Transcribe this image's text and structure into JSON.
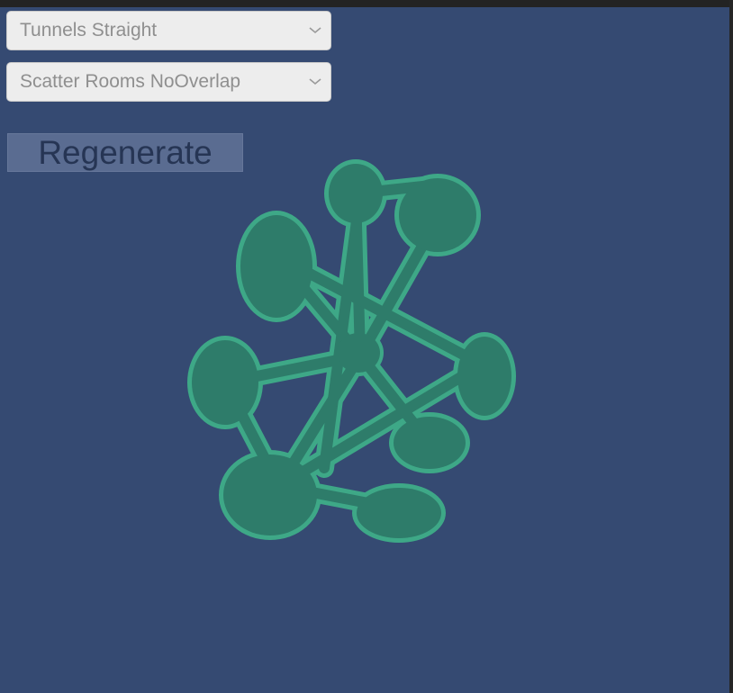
{
  "controls": {
    "tunnel_dropdown": {
      "selected": "Tunnels Straight"
    },
    "rooms_dropdown": {
      "selected": "Scatter Rooms NoOverlap"
    },
    "regenerate_label": "Regenerate"
  },
  "icons": {
    "dropdown_arrow": "chevron-down-icon"
  },
  "colors": {
    "background": "#354a72",
    "room_fill": "#2e7c6a",
    "room_outline": "#3ea887",
    "dropdown_bg": "#ededed",
    "button_bg": "#5a6c91"
  }
}
